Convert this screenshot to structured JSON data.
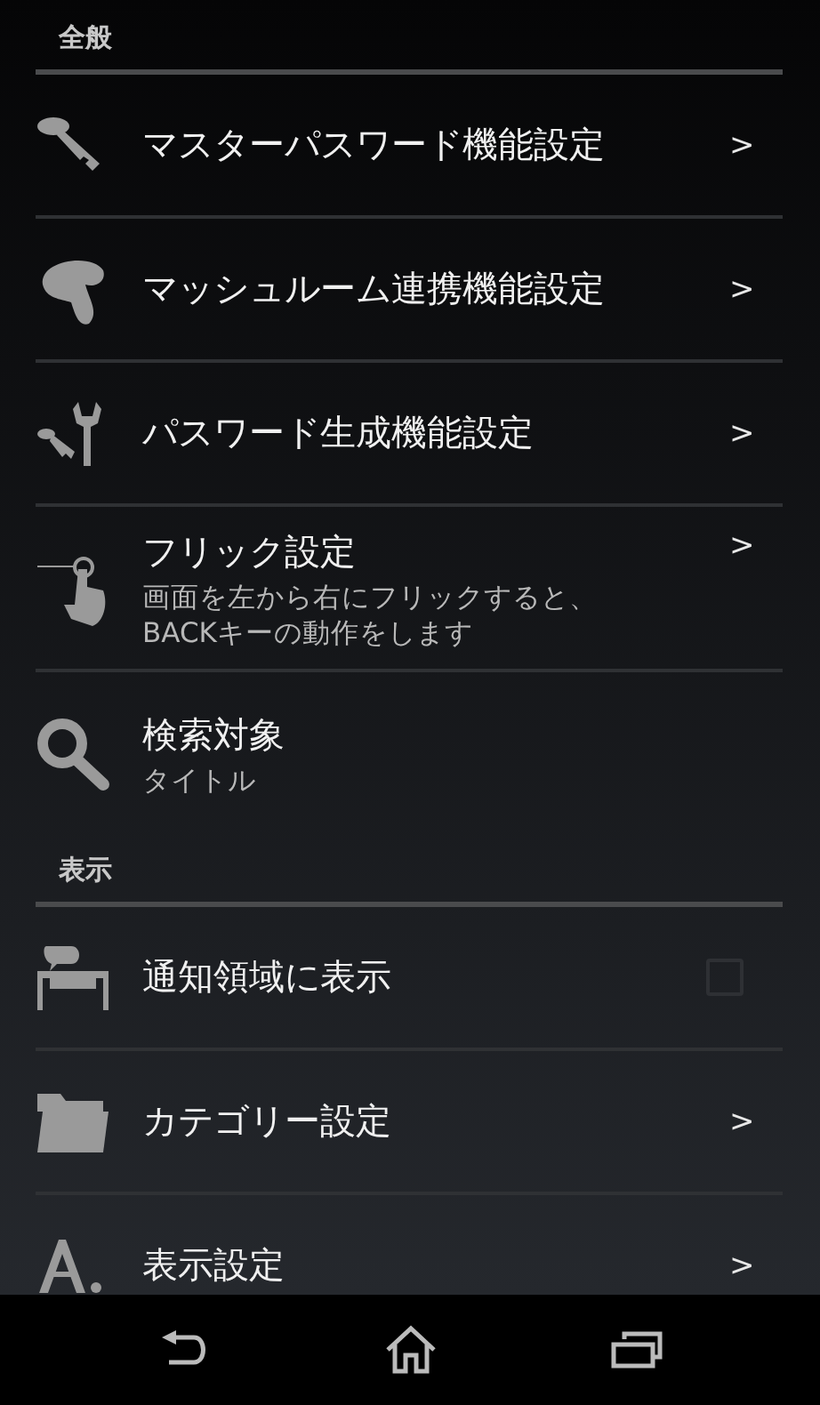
{
  "sections": [
    {
      "header": "全般",
      "items": [
        {
          "kind": "link",
          "title": "マスターパスワード機能設定",
          "arrow": ">"
        },
        {
          "kind": "link",
          "title": "マッシュルーム連携機能設定",
          "arrow": ">"
        },
        {
          "kind": "link",
          "title": "パスワード生成機能設定",
          "arrow": ">"
        },
        {
          "kind": "link",
          "title": "フリック設定",
          "summary": "画面を左から右にフリックすると、BACKキーの動作をします",
          "arrow": ">"
        },
        {
          "kind": "value",
          "title": "検索対象",
          "summary": "タイトル"
        }
      ]
    },
    {
      "header": "表示",
      "items": [
        {
          "kind": "checkbox",
          "title": "通知領域に表示",
          "checked": false
        },
        {
          "kind": "link",
          "title": "カテゴリー設定",
          "arrow": ">"
        },
        {
          "kind": "link",
          "title": "表示設定",
          "arrow": ">"
        }
      ]
    }
  ]
}
